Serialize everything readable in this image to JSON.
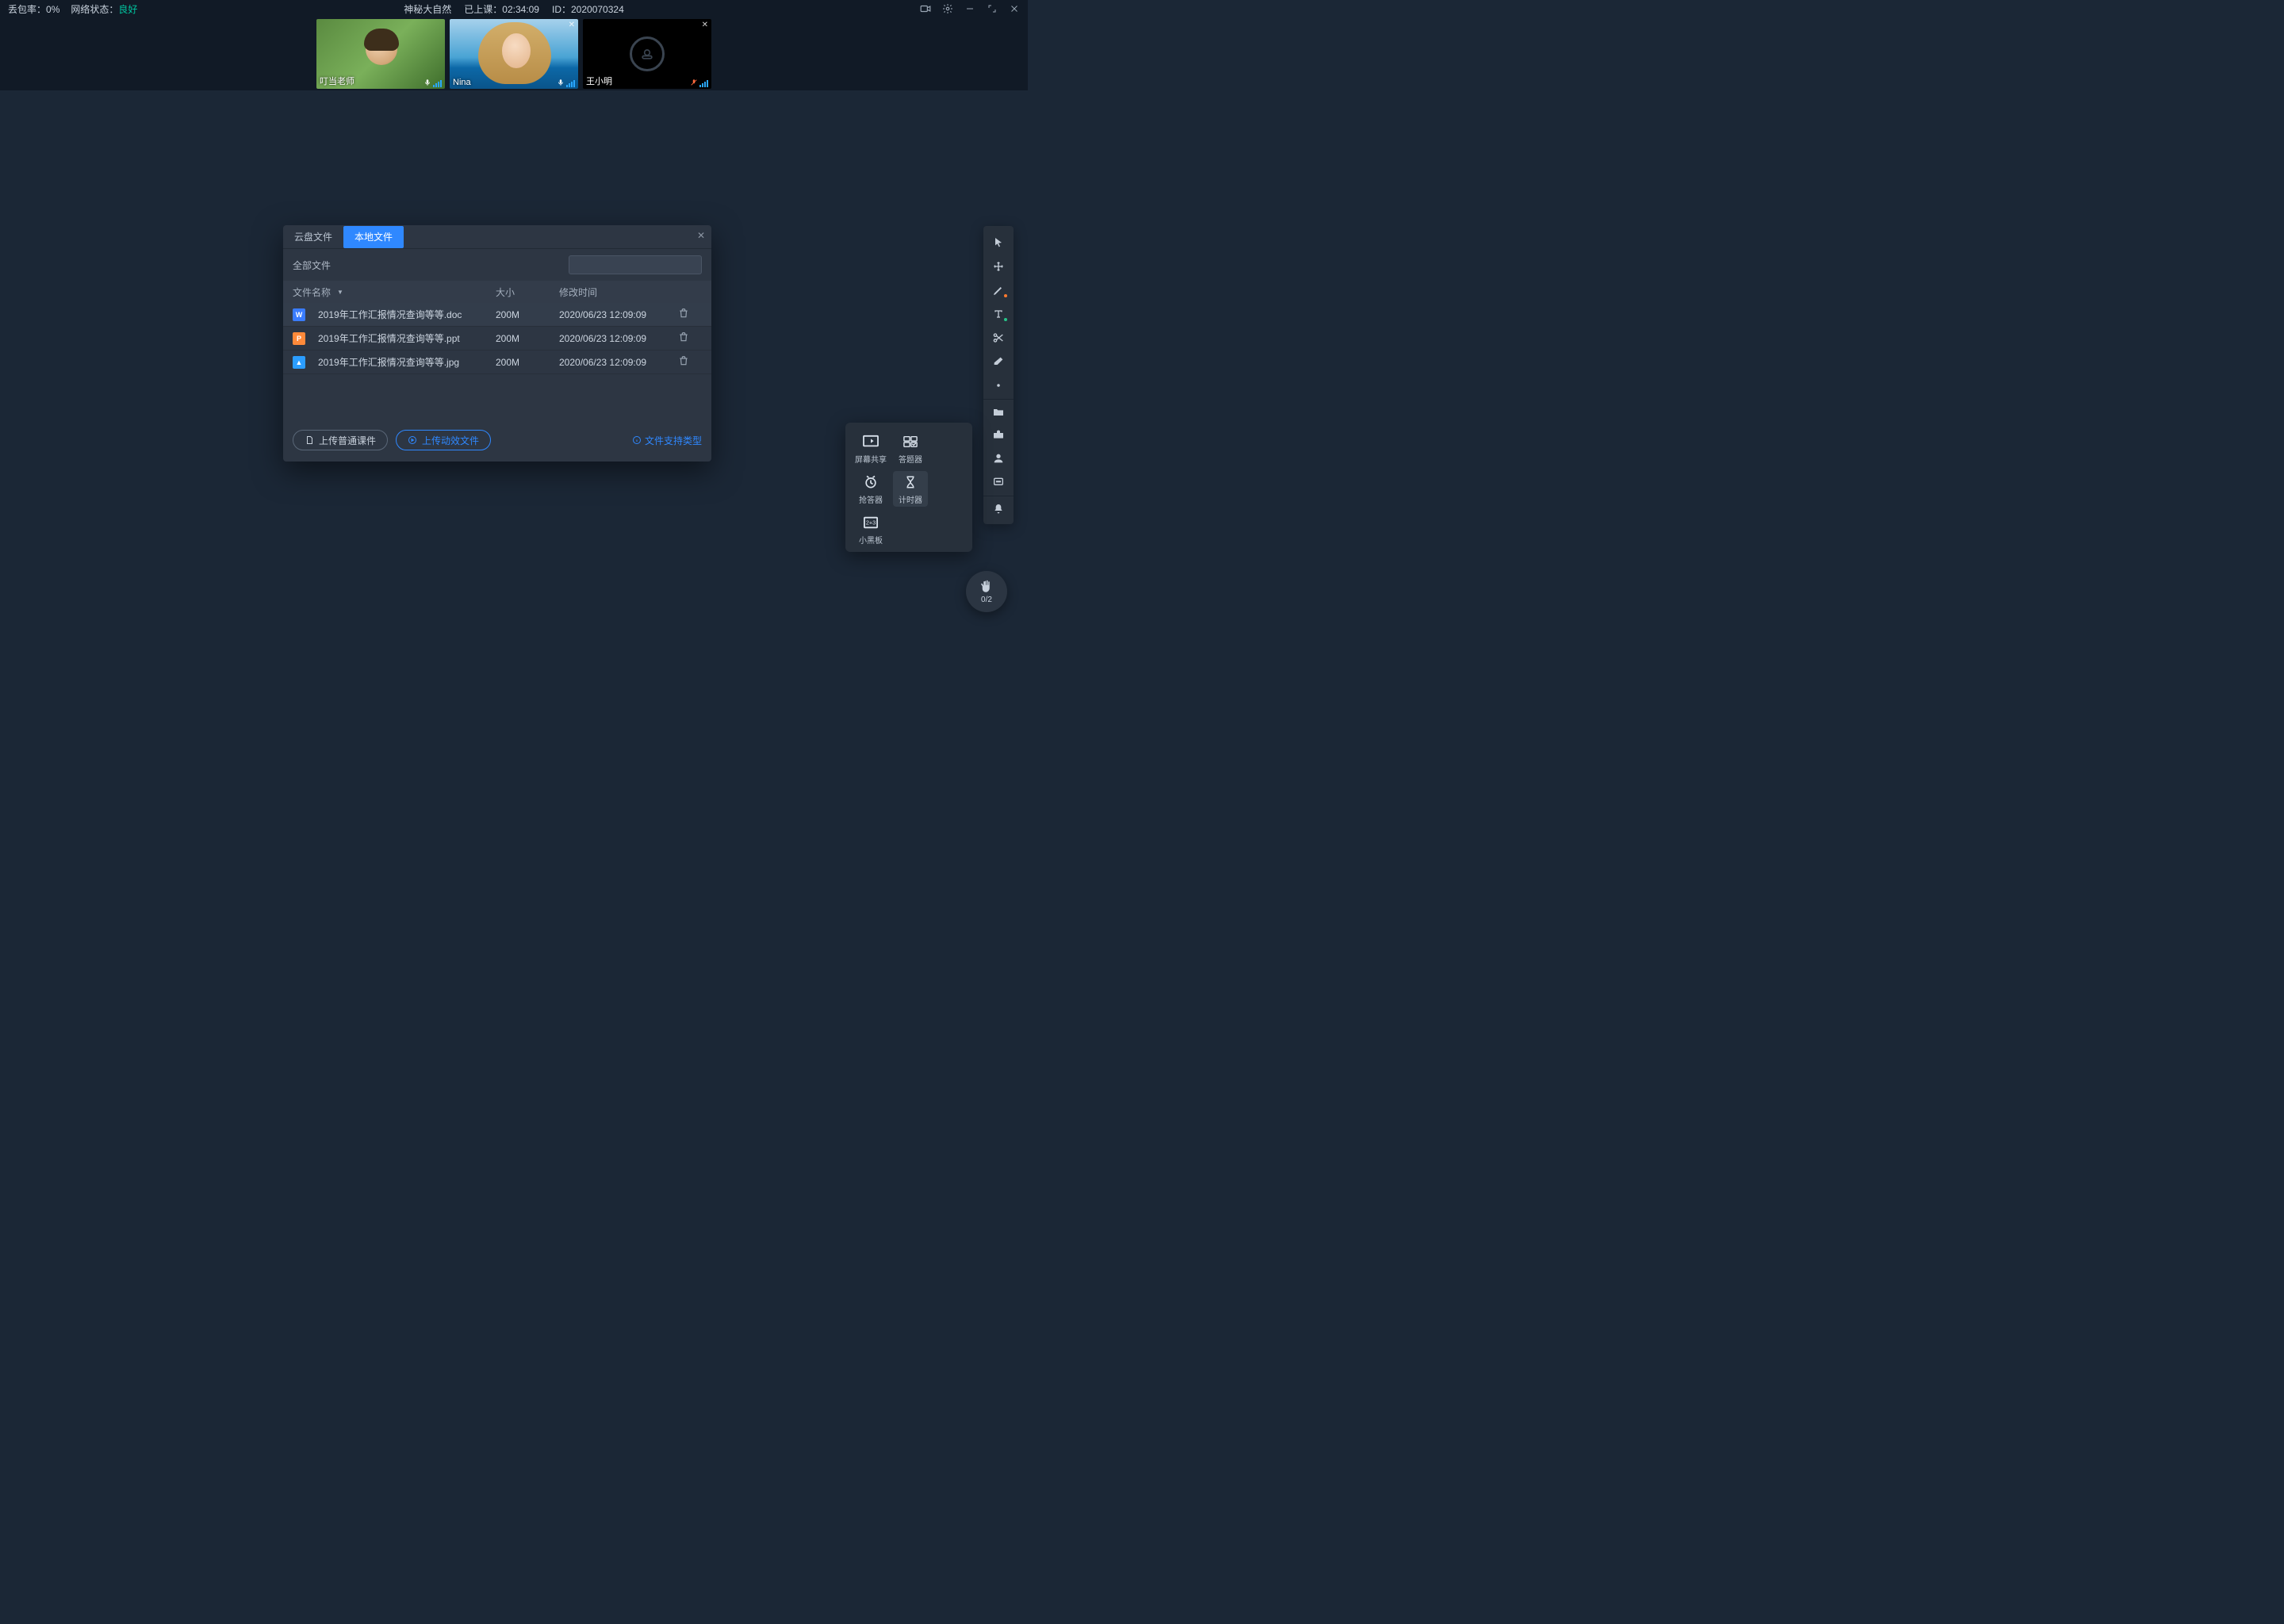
{
  "topbar": {
    "packet_loss_label": "丢包率：",
    "packet_loss_value": "0%",
    "network_label": "网络状态：",
    "network_value": "良好",
    "title": "神秘大自然",
    "elapsed_label": "已上课：",
    "elapsed_value": "02:34:09",
    "id_label": "ID：",
    "id_value": "2020070324"
  },
  "videos": [
    {
      "name": "叮当老师",
      "closable": false,
      "muted": false,
      "camera_off": false
    },
    {
      "name": "Nina",
      "closable": true,
      "muted": false,
      "camera_off": false
    },
    {
      "name": "王小明",
      "closable": true,
      "muted": true,
      "camera_off": true
    }
  ],
  "tools_popup": {
    "items": [
      {
        "label": "屏幕共享",
        "icon": "screen-share"
      },
      {
        "label": "答题器",
        "icon": "quiz"
      },
      {
        "label": "抢答器",
        "icon": "bell"
      },
      {
        "label": "计时器",
        "icon": "hourglass",
        "active": true
      },
      {
        "label": "小黑板",
        "icon": "board"
      }
    ]
  },
  "raise_hand": {
    "count": "0/2"
  },
  "modal": {
    "tabs": [
      {
        "label": "云盘文件",
        "active": false
      },
      {
        "label": "本地文件",
        "active": true
      }
    ],
    "scope": "全部文件",
    "search_placeholder": "",
    "columns": {
      "name": "文件名称",
      "size": "大小",
      "time": "修改时间"
    },
    "files": [
      {
        "icon": "W",
        "icon_class": "w",
        "name": "2019年工作汇报情况查询等等.doc",
        "size": "200M",
        "time": "2020/06/23 12:09:09",
        "highlight": true
      },
      {
        "icon": "P",
        "icon_class": "p",
        "name": "2019年工作汇报情况查询等等.ppt",
        "size": "200M",
        "time": "2020/06/23 12:09:09",
        "highlight": false
      },
      {
        "icon": "▲",
        "icon_class": "i",
        "name": "2019年工作汇报情况查询等等.jpg",
        "size": "200M",
        "time": "2020/06/23 12:09:09",
        "highlight": false
      }
    ],
    "buttons": {
      "upload_normal": "上传普通课件",
      "upload_dynamic": "上传动效文件"
    },
    "support_link": "文件支持类型"
  }
}
